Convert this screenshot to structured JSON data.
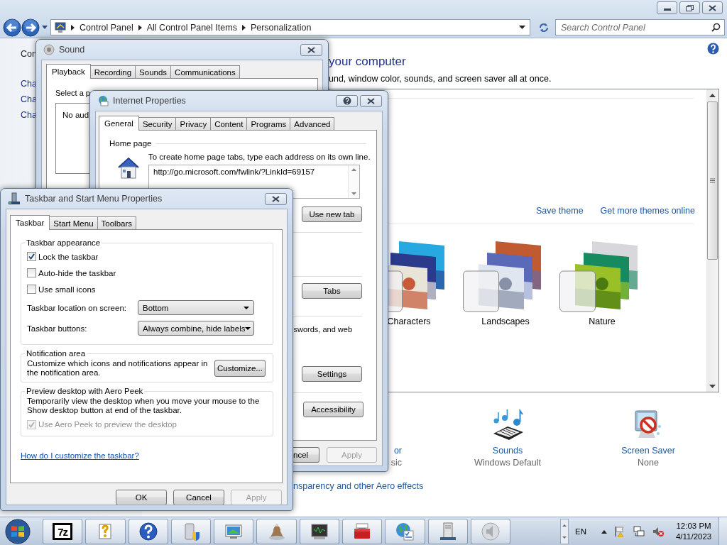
{
  "explorer": {
    "breadcrumbs": [
      "Control Panel",
      "All Control Panel Items",
      "Personalization"
    ],
    "search": {
      "placeholder": "Search Control Panel"
    },
    "sidebar": {
      "title": "Con",
      "links": [
        "Cha",
        "Cha",
        "Cha"
      ]
    },
    "heading": "your computer",
    "subtitle": "und, window color, sounds, and screen saver all at once.",
    "theme_links": [
      "Save theme",
      "Get more themes online"
    ],
    "themes": [
      {
        "name": "Characters",
        "kind": "characters"
      },
      {
        "name": "Landscapes",
        "kind": "landscapes"
      },
      {
        "name": "Nature",
        "kind": "nature"
      }
    ],
    "settings": [
      {
        "label": "or",
        "value": "sic"
      },
      {
        "label": "Sounds",
        "value": "Windows Default",
        "kind": "sounds"
      },
      {
        "label": "Screen Saver",
        "value": "None",
        "kind": "screensaver"
      }
    ],
    "aero_link": "nsparency and other Aero effects"
  },
  "sound_dialog": {
    "title": "Sound",
    "tabs": [
      {
        "label": "Playback",
        "selected": true
      },
      {
        "label": "Recording",
        "selected": false
      },
      {
        "label": "Sounds",
        "selected": false
      },
      {
        "label": "Communications",
        "selected": false
      }
    ],
    "instruction": "Select a p",
    "list_text": "No aud"
  },
  "internet_properties": {
    "title": "Internet Properties",
    "tabs": [
      {
        "label": "General",
        "selected": true
      },
      {
        "label": "Security",
        "selected": false
      },
      {
        "label": "Privacy",
        "selected": false
      },
      {
        "label": "Content",
        "selected": false
      },
      {
        "label": "Programs",
        "selected": false
      },
      {
        "label": "Advanced",
        "selected": false
      }
    ],
    "home_page": {
      "label": "Home page",
      "hint": "To create home page tabs, type each address on its own line.",
      "value": "http://go.microsoft.com/fwlink/?LinkId=69157"
    },
    "buttons": [
      "Use new tab",
      "Tabs",
      "Settings",
      "Accessibility"
    ],
    "browsing_text": "swords, and web",
    "footer_buttons": [
      {
        "label": "ncel",
        "disabled": false
      },
      {
        "label": "Apply",
        "disabled": true
      }
    ]
  },
  "taskbar_properties": {
    "title": "Taskbar and Start Menu Properties",
    "tabs": [
      {
        "label": "Taskbar",
        "selected": true
      },
      {
        "label": "Start Menu",
        "selected": false
      },
      {
        "label": "Toolbars",
        "selected": false
      }
    ],
    "appearance": {
      "title": "Taskbar appearance",
      "checkboxes": [
        {
          "label": "Lock the taskbar",
          "checked": true
        },
        {
          "label": "Auto-hide the taskbar",
          "checked": false
        },
        {
          "label": "Use small icons",
          "checked": false
        }
      ],
      "selects": [
        {
          "label": "Taskbar location on screen:",
          "value": "Bottom"
        },
        {
          "label": "Taskbar buttons:",
          "value": "Always combine, hide labels"
        }
      ]
    },
    "notification": {
      "title": "Notification area",
      "text": "Customize which icons and notifications appear in the notification area.",
      "button": "Customize..."
    },
    "peek": {
      "title": "Preview desktop with Aero Peek",
      "text": "Temporarily view the desktop when you move your mouse to the Show desktop button at end of the taskbar.",
      "checkbox": {
        "label": "Use Aero Peek to preview the desktop",
        "checked": true,
        "disabled": true
      }
    },
    "help_link": "How do I customize the taskbar?",
    "buttons": [
      {
        "label": "OK",
        "disabled": false
      },
      {
        "label": "Cancel",
        "disabled": false
      },
      {
        "label": "Apply",
        "disabled": true
      }
    ]
  },
  "taskbar": {
    "pinned": [
      {
        "kind": "archive",
        "label": "7z"
      },
      {
        "kind": "help-doc"
      },
      {
        "kind": "help"
      },
      {
        "kind": "drive-shield"
      },
      {
        "kind": "monitor"
      },
      {
        "kind": "bell"
      },
      {
        "kind": "terminal"
      },
      {
        "kind": "toolbox"
      },
      {
        "kind": "globe"
      },
      {
        "kind": "server"
      },
      {
        "kind": "speaker"
      }
    ],
    "language": "EN",
    "volume_muted": true,
    "time": "12:03 PM",
    "date": "4/11/2023"
  }
}
